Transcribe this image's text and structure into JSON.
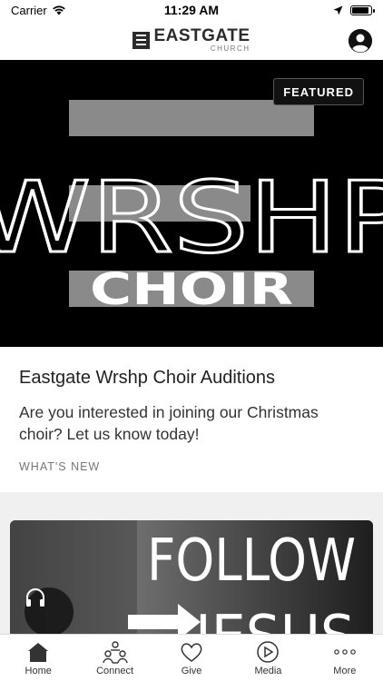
{
  "status_bar": {
    "carrier": "Carrier",
    "time": "11:29 AM",
    "battery_level": 0.9
  },
  "header": {
    "logo_name": "EASTGATE",
    "logo_sub": "CHURCH",
    "profile_icon": "user-circle-icon"
  },
  "featured": {
    "badge": "FEATURED",
    "image_text_top": "WRSHP",
    "image_text_bottom": "CHOIR",
    "title": "Eastgate Wrshp Choir Auditions",
    "description": "Are you interested in joining our Christmas choir?  Let us know today!",
    "category": "WHAT'S NEW"
  },
  "second_card": {
    "image_text_top": "FOLLOW",
    "image_text_bottom": "JESUS",
    "audio_icon": "headphones-icon"
  },
  "tabs": [
    {
      "label": "Home",
      "icon": "home-icon"
    },
    {
      "label": "Connect",
      "icon": "connect-icon"
    },
    {
      "label": "Give",
      "icon": "heart-icon"
    },
    {
      "label": "Media",
      "icon": "play-icon"
    },
    {
      "label": "More",
      "icon": "more-icon"
    }
  ]
}
